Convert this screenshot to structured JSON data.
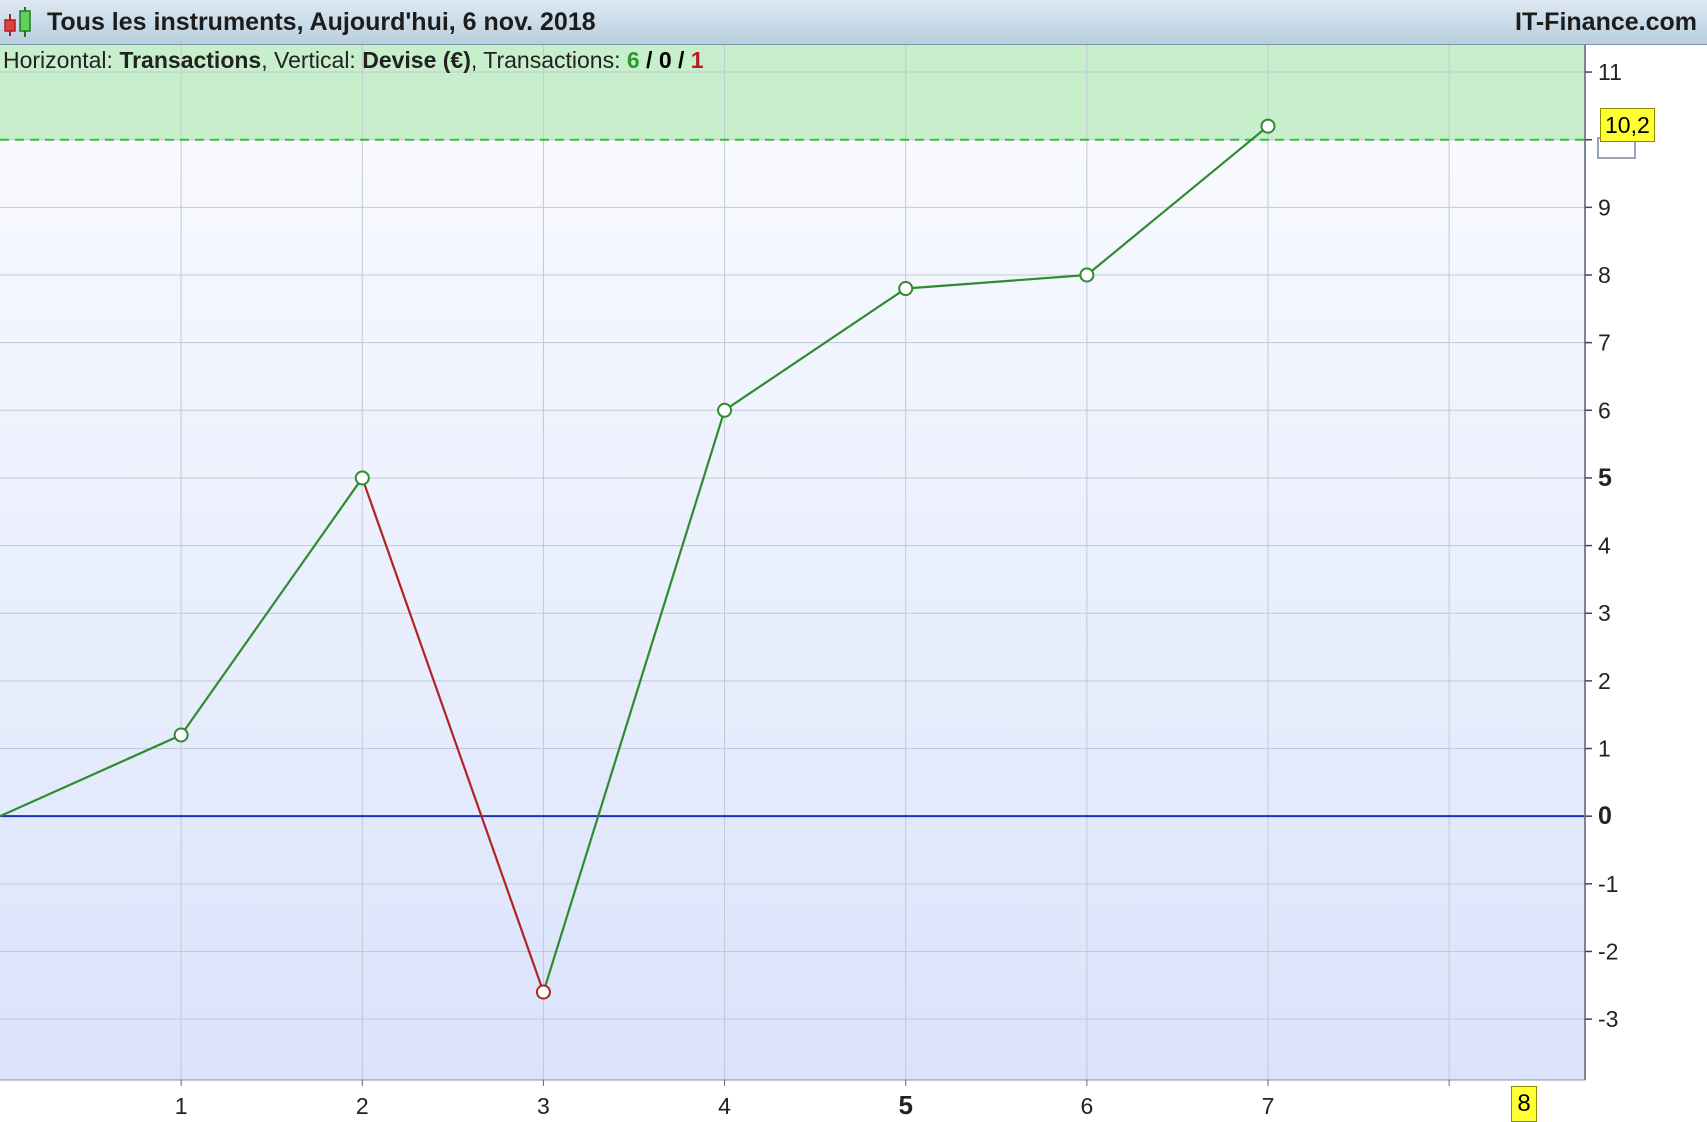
{
  "window": {
    "title": "Tous les instruments, Aujourd'hui, 6 nov. 2018",
    "site": "IT-Finance.com",
    "icon": "candlestick-icon"
  },
  "info": {
    "horizontal_label": "Horizontal:",
    "horizontal_value": "Transactions",
    "vertical_label": ", Vertical:",
    "vertical_value": "Devise (€)",
    "transactions_label": ", Transactions:",
    "win_count": "6",
    "sep1": " / ",
    "neutral_count": "0",
    "sep2": " / ",
    "loss_count": "1"
  },
  "last_value_label": "10,2",
  "x_current_label": "8",
  "colors": {
    "gain": "#2e8b2e",
    "loss": "#b22222",
    "zero_line": "#1f2fbf",
    "target_zone": "#c8efcc"
  },
  "chart_data": {
    "type": "line",
    "x": [
      0,
      1,
      2,
      3,
      4,
      5,
      6,
      7
    ],
    "y": [
      0,
      1.2,
      5.0,
      -2.6,
      6.0,
      7.8,
      8.0,
      10.2
    ],
    "xlim": [
      0,
      8.75
    ],
    "ylim": [
      -3.9,
      11.4
    ],
    "x_ticks": [
      "1",
      "2",
      "3",
      "4",
      "5",
      "6",
      "7",
      "8"
    ],
    "y_ticks": [
      "11",
      "10",
      "9",
      "8",
      "7",
      "6",
      "5",
      "4",
      "3",
      "2",
      "1",
      "0",
      "-1",
      "-2",
      "-3"
    ],
    "zero_line": 0,
    "highlight_zone_from": 10,
    "grid": true
  }
}
